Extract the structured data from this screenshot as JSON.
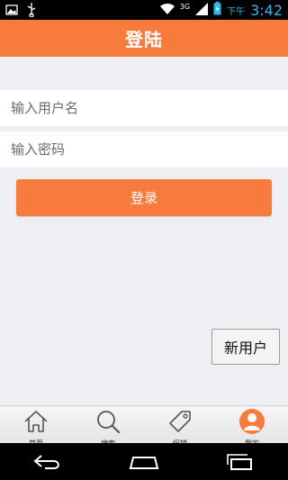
{
  "status": {
    "network": "3G",
    "ampm": "下午",
    "time": "3:42"
  },
  "title": "登陆",
  "form": {
    "username_placeholder": "输入用户名",
    "password_placeholder": "输入密码",
    "login_label": "登录",
    "new_user_label": "新用户"
  },
  "tabs": [
    {
      "label": "首页",
      "icon": "home-icon"
    },
    {
      "label": "搜索",
      "icon": "search-icon"
    },
    {
      "label": "促销",
      "icon": "tag-icon"
    },
    {
      "label": "我的",
      "icon": "user-icon",
      "active": true
    }
  ],
  "colors": {
    "accent": "#f77b3c",
    "status_blue": "#33b5e5",
    "background": "#eeeff3"
  }
}
